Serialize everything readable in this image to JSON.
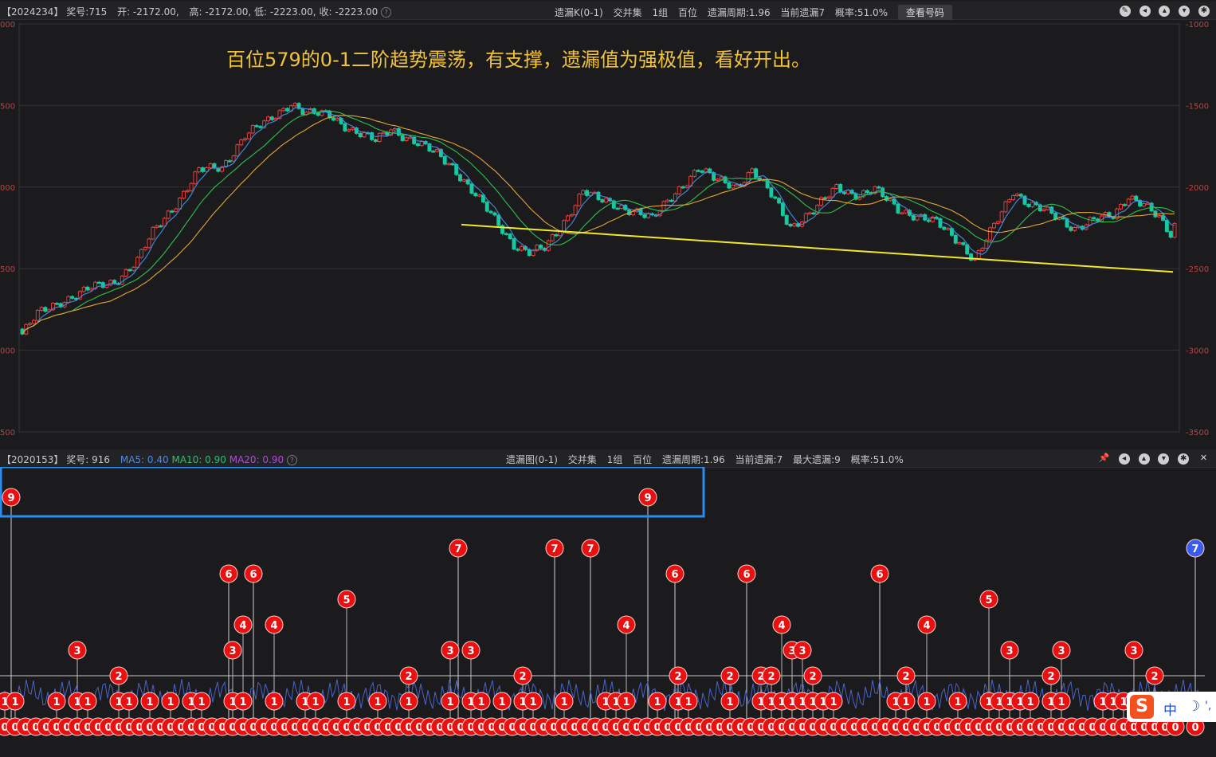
{
  "top_header": {
    "issue": "【2024234】",
    "award": "奖号:715",
    "open": "开: -2172.00,",
    "high": "高: -2172.00,",
    "low": "低: -2223.00,",
    "close": "收: -2223.00",
    "info_items": [
      "遗漏K(0-1)",
      "交并集",
      "1组",
      "百位",
      "遗漏周期:1.96",
      "当前遗漏7",
      "概率:51.0%"
    ],
    "button_label": "查看号码"
  },
  "annotation": "百位579的0-1二阶趋势震荡，有支撑，遗漏值为强极值，看好开出。",
  "y_axis_left": [
    "000",
    "500",
    "000",
    "500",
    "000",
    "500"
  ],
  "y_axis_right": [
    "-1000",
    "-1500",
    "-2000",
    "-2500",
    "-3000",
    "-3500"
  ],
  "bottom_header": {
    "issue": "【2020153】",
    "award": "奖号: 916",
    "ma5": "MA5: 0.40",
    "ma10": "MA10: 0.90",
    "ma20": "MA20: 0.90",
    "info_items": [
      "遗漏图(0-1)",
      "交并集",
      "1组",
      "百位",
      "遗漏周期:1.96",
      "当前遗漏:7",
      "最大遗漏:9",
      "概率:51.0%"
    ]
  },
  "ime": {
    "logo": "S",
    "lang": "中",
    "moon": "☽",
    "punct": "',"
  },
  "colors": {
    "up": "#f04040",
    "down": "#18c9a0",
    "ma5": "#3f8ee6",
    "ma10": "#2fbf4f",
    "ma20": "#e0a63a",
    "trend": "#f0e82a",
    "ball": "#e81010",
    "ball_current": "#3a5bf0",
    "highlight": "#2b8cf0"
  },
  "chart_data": {
    "type": "candlestick",
    "title": "百位579的0-1二阶趋势震荡，有支撑，遗漏值为强极值，看好开出。",
    "y_range": [
      -3500,
      -1000
    ],
    "last_bar": {
      "open": -2172,
      "high": -2172,
      "low": -2223,
      "close": -2223
    },
    "price_path_points": [
      [
        0,
        -2900
      ],
      [
        4,
        -2780
      ],
      [
        10,
        -2700
      ],
      [
        18,
        -2620
      ],
      [
        24,
        -2580
      ],
      [
        30,
        -2450
      ],
      [
        34,
        -2280
      ],
      [
        40,
        -2100
      ],
      [
        46,
        -1900
      ],
      [
        52,
        -1880
      ],
      [
        58,
        -1680
      ],
      [
        64,
        -1600
      ],
      [
        70,
        -1480
      ],
      [
        74,
        -1550
      ],
      [
        80,
        -1560
      ],
      [
        86,
        -1650
      ],
      [
        92,
        -1720
      ],
      [
        96,
        -1640
      ],
      [
        102,
        -1720
      ],
      [
        108,
        -1800
      ],
      [
        112,
        -1870
      ],
      [
        118,
        -2050
      ],
      [
        124,
        -2230
      ],
      [
        128,
        -2350
      ],
      [
        132,
        -2400
      ],
      [
        136,
        -2380
      ],
      [
        140,
        -2250
      ],
      [
        146,
        -2020
      ],
      [
        150,
        -2080
      ],
      [
        156,
        -2120
      ],
      [
        160,
        -2150
      ],
      [
        164,
        -2200
      ],
      [
        170,
        -2030
      ],
      [
        176,
        -1890
      ],
      [
        180,
        -1950
      ],
      [
        186,
        -1990
      ],
      [
        190,
        -1900
      ],
      [
        196,
        -2080
      ],
      [
        200,
        -2240
      ],
      [
        206,
        -2150
      ],
      [
        212,
        -2000
      ],
      [
        218,
        -2050
      ],
      [
        222,
        -2020
      ],
      [
        228,
        -2130
      ],
      [
        234,
        -2190
      ],
      [
        238,
        -2220
      ],
      [
        244,
        -2330
      ],
      [
        248,
        -2450
      ],
      [
        254,
        -2200
      ],
      [
        258,
        -2020
      ],
      [
        262,
        -2100
      ],
      [
        268,
        -2170
      ],
      [
        274,
        -2250
      ],
      [
        278,
        -2210
      ],
      [
        284,
        -2180
      ],
      [
        288,
        -2050
      ],
      [
        292,
        -2100
      ],
      [
        296,
        -2200
      ],
      [
        300,
        -2330
      ]
    ],
    "trend_line": {
      "start": [
        0,
        -2230
      ],
      "end": [
        1,
        -2520
      ]
    },
    "lower_panel": {
      "type": "miss_values",
      "max_miss": 9,
      "current_miss": 7,
      "row_labels": [
        "9",
        "7",
        "6",
        "5",
        "4",
        "3",
        "2",
        "1"
      ],
      "highlighted": [
        {
          "label": "9",
          "position": 0
        },
        {
          "label": "9",
          "position": 0.53
        }
      ],
      "tall_markers": [
        {
          "label": "7",
          "position": 0.38
        },
        {
          "label": "7",
          "position": 0.46
        },
        {
          "label": "7",
          "position": 0.49
        },
        {
          "label": "6",
          "position": 0.19
        },
        {
          "label": "6",
          "position": 0.21
        },
        {
          "label": "6",
          "position": 0.56
        },
        {
          "label": "6",
          "position": 0.62
        },
        {
          "label": "6",
          "position": 0.73
        }
      ],
      "current_marker": {
        "label": "7",
        "bottom_label": "0"
      }
    }
  }
}
